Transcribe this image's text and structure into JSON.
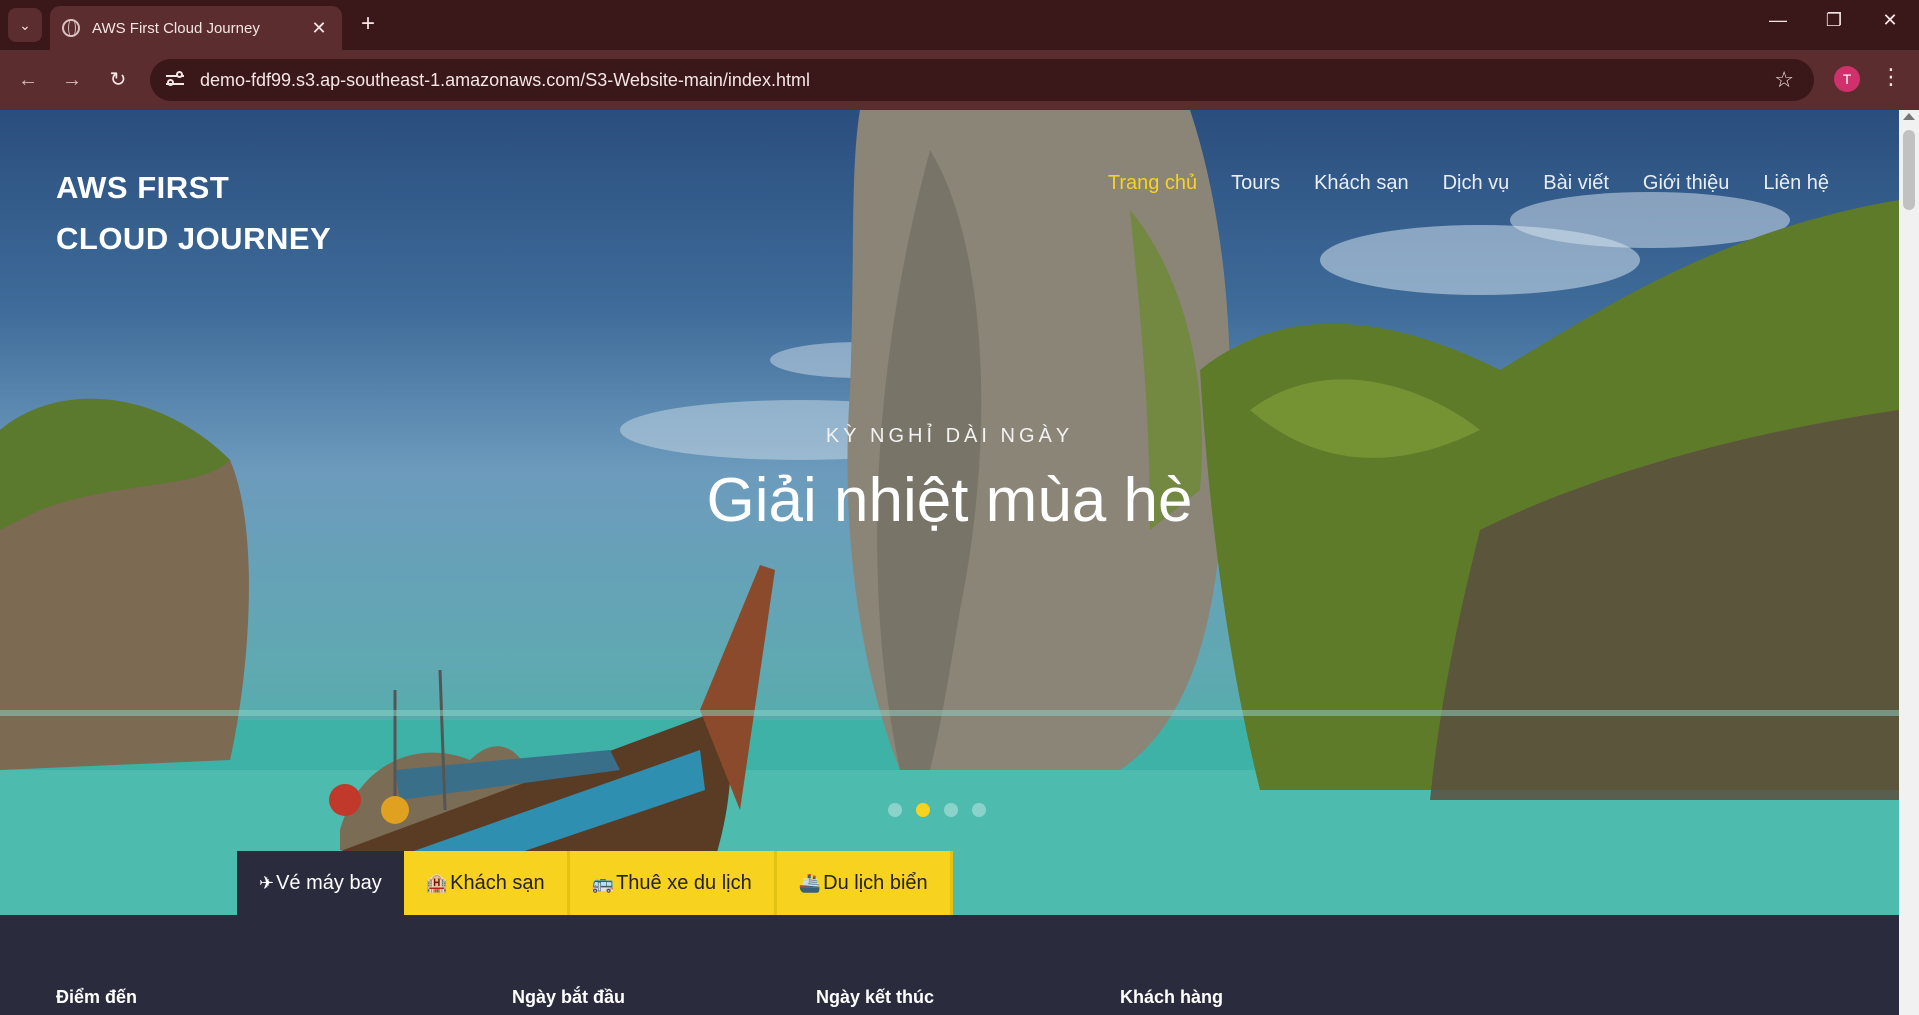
{
  "browser": {
    "tab_title": "AWS First Cloud Journey",
    "url": "demo-fdf99.s3.ap-southeast-1.amazonaws.com/S3-Website-main/index.html",
    "profile_initial": "T",
    "colors": {
      "frame": "#3a1718",
      "toolbar": "#5b2d2f"
    }
  },
  "site": {
    "logo_line1": "AWS FIRST",
    "logo_line2": "CLOUD JOURNEY",
    "nav": [
      "Trang chủ",
      "Tours",
      "Khách sạn",
      "Dịch vụ",
      "Bài viết",
      "Giới thiệu",
      "Liên hệ"
    ],
    "active_nav": "Trang chủ",
    "accent_color": "#f7d21e"
  },
  "hero": {
    "kicker": "KỲ NGHỈ DÀI NGÀY",
    "headline": "Giải nhiệt mùa hè",
    "slide_count": 4,
    "active_slide": 2
  },
  "search_tabs": [
    {
      "label": "Vé máy bay",
      "icon": "airplane-icon",
      "glyph": "✈",
      "active": true
    },
    {
      "label": "Khách sạn",
      "icon": "hotel-icon",
      "glyph": "🏨",
      "active": false
    },
    {
      "label": "Thuê xe du lịch",
      "icon": "bus-icon",
      "glyph": "🚌",
      "active": false
    },
    {
      "label": "Du lịch biển",
      "icon": "ship-icon",
      "glyph": "🚢",
      "active": false
    }
  ],
  "form": {
    "destination_label": "Điểm đến",
    "start_label": "Ngày bắt đầu",
    "end_label": "Ngày kết thúc",
    "guests_label": "Khách hàng"
  }
}
